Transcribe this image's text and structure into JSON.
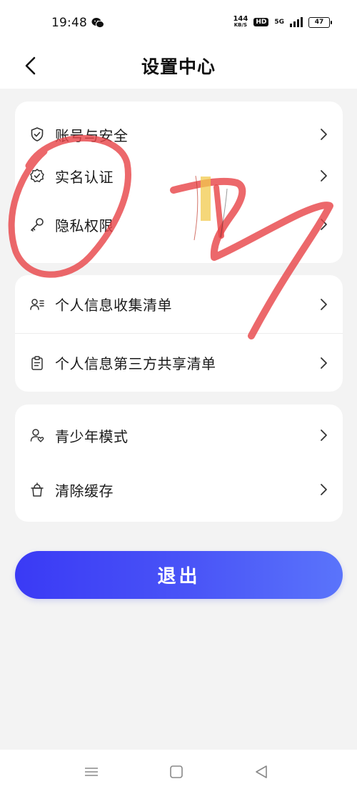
{
  "status_bar": {
    "time": "19:48",
    "net_speed_value": "144",
    "net_speed_unit": "KB/S",
    "hd": "HD",
    "signal": "5G",
    "battery": "47"
  },
  "header": {
    "title": "设置中心",
    "back_icon": "chevron-left-icon"
  },
  "groups": [
    {
      "items": [
        {
          "label": "账号与安全",
          "icon": "shield-check-icon"
        },
        {
          "label": "实名认证",
          "icon": "badge-check-icon"
        },
        {
          "label": "隐私权限",
          "icon": "key-icon"
        }
      ]
    },
    {
      "items": [
        {
          "label": "个人信息收集清单",
          "icon": "user-list-icon"
        },
        {
          "label": "个人信息第三方共享清单",
          "icon": "clipboard-icon"
        }
      ]
    },
    {
      "items": [
        {
          "label": "青少年模式",
          "icon": "user-heart-icon"
        },
        {
          "label": "清除缓存",
          "icon": "trash-icon"
        }
      ]
    }
  ],
  "logout_label": "退出",
  "colors": {
    "accent_start": "#3a3af5",
    "accent_end": "#5a74fb",
    "background": "#f3f3f3",
    "card": "#ffffff",
    "scribble": "#e8474a"
  }
}
